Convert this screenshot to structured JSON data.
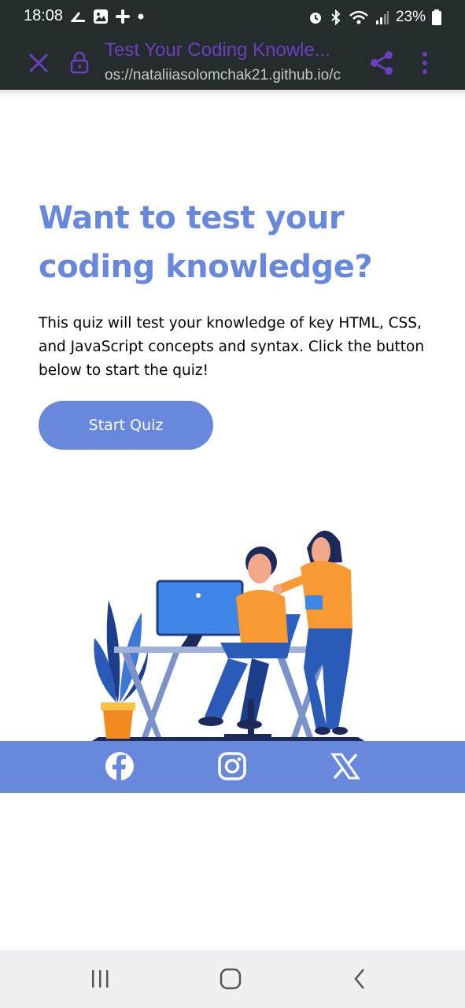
{
  "status_bar": {
    "time": "18:08",
    "battery": "23%",
    "icons": [
      "running-shoe-icon",
      "gallery-icon",
      "slack-icon",
      "dot-icon",
      "alarm-icon",
      "bluetooth-icon",
      "wifi-icon",
      "signal-icon",
      "battery-icon"
    ]
  },
  "browser": {
    "page_title": "Test Your Coding Knowle...",
    "url": "os://nataliiasolomchak21.github.io/c",
    "icons": [
      "close-icon",
      "lock-icon",
      "share-icon",
      "more-vert-icon"
    ]
  },
  "main": {
    "heading_line1": "Want to test your",
    "heading_line2": "coding knowledge?",
    "description": "This quiz will test your knowledge of key HTML, CSS, and JavaScript concepts and syntax. Click the button below to start the quiz!",
    "start_button": "Start Quiz"
  },
  "footer": {
    "social_icons": [
      "facebook-icon",
      "instagram-icon",
      "x-icon"
    ]
  },
  "nav_bar": {
    "icons": [
      "recents-icon",
      "home-icon",
      "back-icon"
    ]
  },
  "colors": {
    "accent": "#6888dc",
    "toolbar_bg": "#252c2e",
    "title_purple": "#6b3fbf",
    "text": "#000000"
  }
}
